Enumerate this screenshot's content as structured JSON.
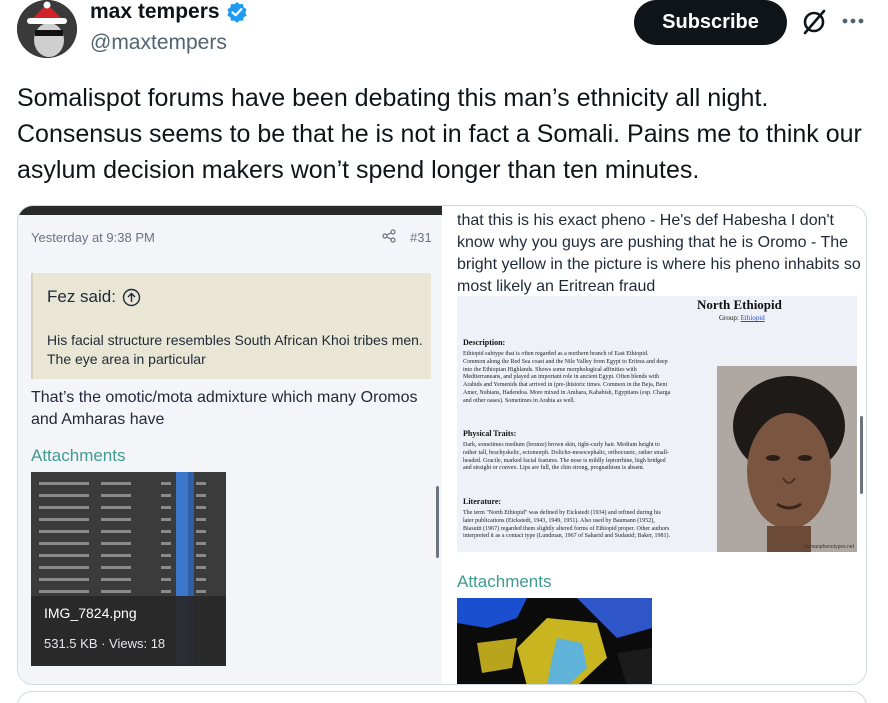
{
  "tweet": {
    "display_name": "max tempers",
    "handle": "@maxtempers",
    "subscribe_label": "Subscribe",
    "icons": {
      "verified": "verified-badge-icon",
      "grok": "grok-icon",
      "more": "more-icon"
    },
    "text": "Somalispot forums have been debating this man’s ethnicity all night. Consensus seems to be that he is not in fact a Somali. Pains me to think our asylum decision makers won’t spend longer than ten minutes."
  },
  "forum_post": {
    "date": "Yesterday at 9:38 PM",
    "post_number": "#31",
    "quote_author": "Fez said:",
    "quote_text": "His facial structure resembles South African Khoi tribes men. The eye area in particular",
    "reply_text": "That’s the omotic/mota admixture which many Oromos and Amharas have",
    "attachments_label": "Attachments",
    "attachment": {
      "filename": "IMG_7824.png",
      "meta": "531.5 KB · Views: 18"
    }
  },
  "right_post": {
    "text": "that this is his exact pheno - He's def Habesha I don't know why you guys are pushing that he is Oromo - The bright yellow in the picture is where his pheno inhabits so most likely an Eritrean fraud",
    "attachments_label": "Attachments",
    "reference": {
      "title": "North Ethiopid",
      "group_label": "Group:",
      "group_link": "Ethiopid",
      "description_heading": "Description:",
      "description": "Ethiopid subtype that is often regarded as a northern branch of East Ethiopid. Common along the Red Sea coast and the Nile Valley from Egypt to Eritrea and deep into the Ethiopian Highlands. Shows some morphological affinities with Mediterraneans, and played an important role in ancient Egypt. Often blends with Arabids and Yemenids that arrived in (pre-)historic times. Common in the Beja, Beni Amer, Nubians, Hadendoa. More mixed in Amhara, Kababish, Egyptians (esp. Charga and other oases). Sometimes in Arabia as well.",
      "traits_heading": "Physical Traits:",
      "traits": "Dark, sometimes medium (bronze) brown skin, tight-curly hair. Medium height to rather tall, brachyskelic, ectomorph. Dolicho-mesocephalic, orthocranic, rather small-headed. Gracile, marked facial features. The nose is mildly leptorrhine, high bridged and straight or convex. Lips are full, the chin strong, prognathism is absent.",
      "literature_heading": "Literature:",
      "literature": "The term \"North Ethiopid\" was defined by Eickstedt (1934) and refined during his later publications (Eickstedt, 1943, 1949, 1951). Also used by Baumann (1952), Biasutti (1967) regarded them slightly altered forms of Ethiopid proper. Other authors interpreted it as a contact type (Lundman, 1967 of Saharid and Sudanid; Baker, 1981).",
      "watermark": "humanphenotypes.net"
    }
  },
  "colors": {
    "accent_teal": "#3f9b8f",
    "subscribe_bg": "#0f1419",
    "verified_blue": "#1d9bf0",
    "quote_bg": "#e9e6d6",
    "forum_bg": "#f4f5f9"
  }
}
